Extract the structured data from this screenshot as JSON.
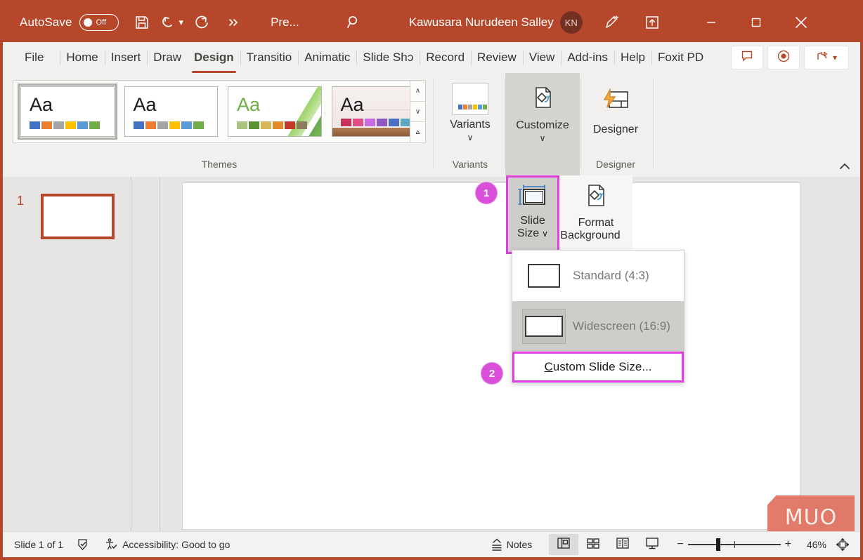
{
  "titlebar": {
    "autosave_label": "AutoSave",
    "autosave_state": "Off",
    "save_icon": "save-icon",
    "undo_icon": "undo-icon",
    "redo_icon": "redo-icon",
    "more_icon": "more-commands-icon",
    "document_title": "Pre...",
    "search_icon": "search-icon",
    "user_name": "Kawusara Nurudeen Salley",
    "avatar_initials": "KN",
    "pen_icon": "ink-pen-icon",
    "present_icon": "present-in-teams-icon",
    "minimize_label": "–",
    "maximize_label": "□",
    "close_label": "✕",
    "bg_color": "#b7472a"
  },
  "tabs": [
    {
      "label": "File",
      "active": false
    },
    {
      "label": "Home",
      "active": false
    },
    {
      "label": "Insert",
      "active": false
    },
    {
      "label": "Draw",
      "active": false
    },
    {
      "label": "Design",
      "active": true
    },
    {
      "label": "Transitio",
      "active": false
    },
    {
      "label": "Animatic",
      "active": false
    },
    {
      "label": "Slide Shɔ",
      "active": false
    },
    {
      "label": "Record",
      "active": false
    },
    {
      "label": "Review",
      "active": false
    },
    {
      "label": "View",
      "active": false
    },
    {
      "label": "Add-ins",
      "active": false
    },
    {
      "label": "Help",
      "active": false
    },
    {
      "label": "Foxit PD",
      "active": false
    }
  ],
  "tab_right_buttons": [
    {
      "name": "comments-button",
      "icon": "comment-icon"
    },
    {
      "name": "record-button",
      "icon": "record-circle-icon"
    },
    {
      "name": "share-button",
      "icon": "share-icon"
    }
  ],
  "ribbon": {
    "themes": {
      "group_label": "Themes",
      "thumbnails": [
        {
          "aa": "Aa",
          "selected": true,
          "swatches": [
            "#4472c4",
            "#ed7d31",
            "#a5a5a5",
            "#ffc000",
            "#5b9bd5",
            "#70ad47"
          ]
        },
        {
          "aa": "Aa",
          "selected": false,
          "swatches": [
            "#4472c4",
            "#ed7d31",
            "#a5a5a5",
            "#ffc000",
            "#5b9bd5",
            "#70ad47"
          ]
        },
        {
          "aa": "Aa",
          "selected": false,
          "swatches": [
            "#a9c47f",
            "#5a9132",
            "#d6b656",
            "#e08a2e",
            "#c0392b",
            "#8c7b5e"
          ]
        },
        {
          "aa": "Aa",
          "selected": false,
          "swatches": [
            "#c9315b",
            "#e05088",
            "#c86ae0",
            "#8e5ac0",
            "#4a6fc4",
            "#5ea8c4"
          ]
        }
      ],
      "scroll_up": "∧",
      "scroll_down": "∨",
      "scroll_more": "⩟"
    },
    "variants": {
      "button_label": "Variants",
      "group_label": "Variants",
      "chevron": "∨",
      "swatches": [
        "#4472c4",
        "#ed7d31",
        "#a5a5a5",
        "#ffc000",
        "#5b9bd5",
        "#70ad47"
      ]
    },
    "customize": {
      "button_label": "Customize",
      "chevron": "∨",
      "icon": "customize-icon"
    },
    "designer": {
      "button_label": "Designer",
      "group_label": "Designer",
      "icon": "designer-icon"
    },
    "collapse_icon": "collapse-ribbon-icon"
  },
  "customize_panel": {
    "slide_size": {
      "label_line1": "Slide",
      "label_line2": "Size",
      "chevron": "∨",
      "icon": "slide-size-icon",
      "highlight_color": "#e040e0"
    },
    "format_background": {
      "label_line1": "Format",
      "label_line2": "Background",
      "icon": "format-background-icon"
    }
  },
  "dropdown": {
    "items": [
      {
        "label": "Standard (4:3)",
        "selected": false,
        "icon": "slide-4-3-icon"
      },
      {
        "label": "Widescreen (16:9)",
        "selected": true,
        "icon": "slide-16-9-icon"
      }
    ],
    "custom": {
      "accel": "C",
      "rest": "ustom Slide Size...",
      "highlight_color": "#e040e0"
    }
  },
  "callouts": [
    {
      "number": "1",
      "color": "#d94fd9"
    },
    {
      "number": "2",
      "color": "#d94fd9"
    }
  ],
  "thumbnail_pane": {
    "slide_number": "1"
  },
  "statusbar": {
    "slide_count": "Slide 1 of 1",
    "spellcheck_icon": "spellcheck-icon",
    "accessibility_icon": "accessibility-icon",
    "accessibility_text": "Accessibility: Good to go",
    "notes_label": "Notes",
    "notes_icon": "notes-icon",
    "views": [
      {
        "name": "normal-view-button",
        "icon": "normal-view-icon",
        "active": true
      },
      {
        "name": "slide-sorter-button",
        "icon": "slide-sorter-icon",
        "active": false
      },
      {
        "name": "reading-view-button",
        "icon": "reading-view-icon",
        "active": false
      },
      {
        "name": "slideshow-button",
        "icon": "slideshow-icon",
        "active": false
      }
    ],
    "zoom_out": "−",
    "zoom_in": "+",
    "zoom_level": "46%",
    "fit_icon": "fit-to-window-icon"
  },
  "watermark": {
    "text": "MUO",
    "color": "#e0725f"
  }
}
